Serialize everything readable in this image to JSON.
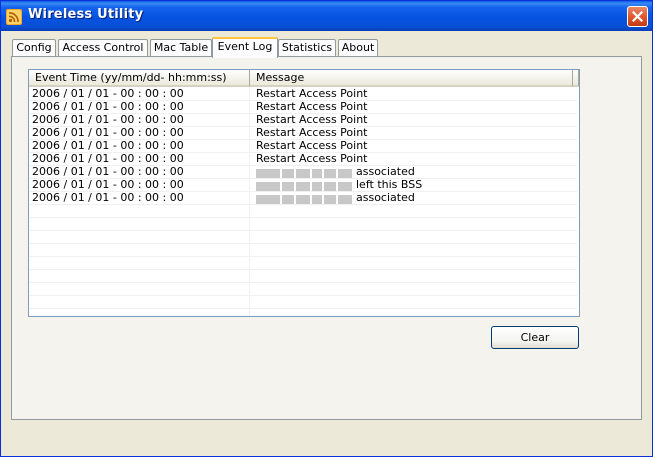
{
  "window": {
    "title": "Wireless Utility",
    "close_icon": "close-icon",
    "app_icon": "wireless-icon"
  },
  "tabs": [
    {
      "label": "Config",
      "active": false
    },
    {
      "label": "Access Control",
      "active": false
    },
    {
      "label": "Mac Table",
      "active": false
    },
    {
      "label": "Event Log",
      "active": true
    },
    {
      "label": "Statistics",
      "active": false
    },
    {
      "label": "About",
      "active": false
    }
  ],
  "event_log": {
    "columns": [
      "Event Time (yy/mm/dd- hh:mm:ss)",
      "Message"
    ],
    "rows": [
      {
        "time": "2006 / 01 / 01 - 00 : 00 : 00",
        "message": "Restart Access Point",
        "redacted": false
      },
      {
        "time": "2006 / 01 / 01 - 00 : 00 : 00",
        "message": "Restart Access Point",
        "redacted": false
      },
      {
        "time": "2006 / 01 / 01 - 00 : 00 : 00",
        "message": "Restart Access Point",
        "redacted": false
      },
      {
        "time": "2006 / 01 / 01 - 00 : 00 : 00",
        "message": "Restart Access Point",
        "redacted": false
      },
      {
        "time": "2006 / 01 / 01 - 00 : 00 : 00",
        "message": "Restart Access Point",
        "redacted": false
      },
      {
        "time": "2006 / 01 / 01 - 00 : 00 : 00",
        "message": "Restart Access Point",
        "redacted": false
      },
      {
        "time": "2006 / 01 / 01 - 00 : 00 : 00",
        "message": "associated",
        "redacted": true
      },
      {
        "time": "2006 / 01 / 01 - 00 : 00 : 00",
        "message": "left this BSS",
        "redacted": true
      },
      {
        "time": "2006 / 01 / 01 - 00 : 00 : 00",
        "message": "associated",
        "redacted": true
      }
    ]
  },
  "buttons": {
    "clear_label": "Clear"
  },
  "colors": {
    "title_bar": "#0553e0",
    "close_button": "#e0592e",
    "active_tab_accent": "#ffc83c",
    "background": "#ece9d8"
  }
}
